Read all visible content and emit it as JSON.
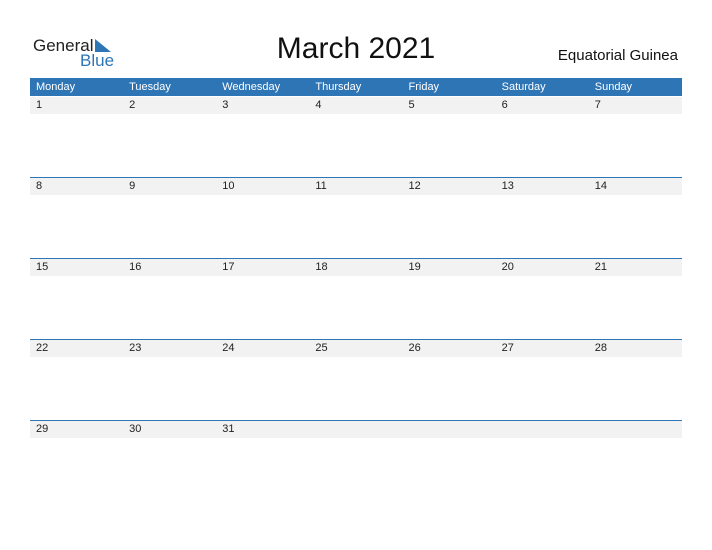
{
  "logo": {
    "text_general": "General",
    "text_blue": "Blue"
  },
  "title": "March 2021",
  "country": "Equatorial Guinea",
  "weekdays": [
    "Monday",
    "Tuesday",
    "Wednesday",
    "Thursday",
    "Friday",
    "Saturday",
    "Sunday"
  ],
  "weeks": [
    [
      "1",
      "2",
      "3",
      "4",
      "5",
      "6",
      "7"
    ],
    [
      "8",
      "9",
      "10",
      "11",
      "12",
      "13",
      "14"
    ],
    [
      "15",
      "16",
      "17",
      "18",
      "19",
      "20",
      "21"
    ],
    [
      "22",
      "23",
      "24",
      "25",
      "26",
      "27",
      "28"
    ],
    [
      "29",
      "30",
      "31",
      "",
      "",
      "",
      ""
    ]
  ],
  "colors": {
    "accent": "#2e75b6",
    "strip": "#f2f2f2"
  }
}
